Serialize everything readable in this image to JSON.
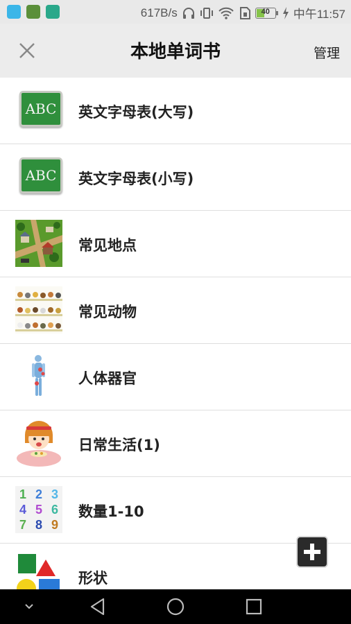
{
  "status_bar": {
    "speed": "617B/s",
    "battery": "40",
    "battery_level_percent": 40,
    "time": "中午11:57",
    "icons": [
      "app-notification-icon",
      "game-notification-icon",
      "tv-notification-icon",
      "headphones-icon",
      "vibrate-icon",
      "wifi-icon",
      "sim-icon",
      "battery-icon",
      "charging-icon"
    ]
  },
  "header": {
    "title": "本地单词书",
    "manage_label": "管理",
    "close_icon": "close-icon"
  },
  "books": [
    {
      "label": "英文字母表(大写)",
      "icon": "abc-chalkboard-icon"
    },
    {
      "label": "英文字母表(小写)",
      "icon": "abc-chalkboard-icon"
    },
    {
      "label": "常见地点",
      "icon": "town-map-icon"
    },
    {
      "label": "常见动物",
      "icon": "animals-icon"
    },
    {
      "label": "人体器官",
      "icon": "human-anatomy-icon"
    },
    {
      "label": "日常生活(1)",
      "icon": "girl-eating-icon"
    },
    {
      "label": "数量1-10",
      "icon": "numbers-grid-icon"
    },
    {
      "label": "形状",
      "icon": "shapes-icon"
    }
  ],
  "thumb_text": {
    "abc": "ABC",
    "numbers": [
      "1",
      "2",
      "3",
      "4",
      "5",
      "6",
      "7",
      "8",
      "9"
    ]
  },
  "fab": {
    "icon": "plus-icon"
  },
  "nav_bar": {
    "icons": [
      "chevron-down-icon",
      "back-icon",
      "home-icon",
      "recents-icon"
    ]
  },
  "colors": {
    "accent_green": "#2f8f3c",
    "battery_green": "#86c34a",
    "nav_bg": "#000000",
    "header_bg": "#ececec"
  }
}
